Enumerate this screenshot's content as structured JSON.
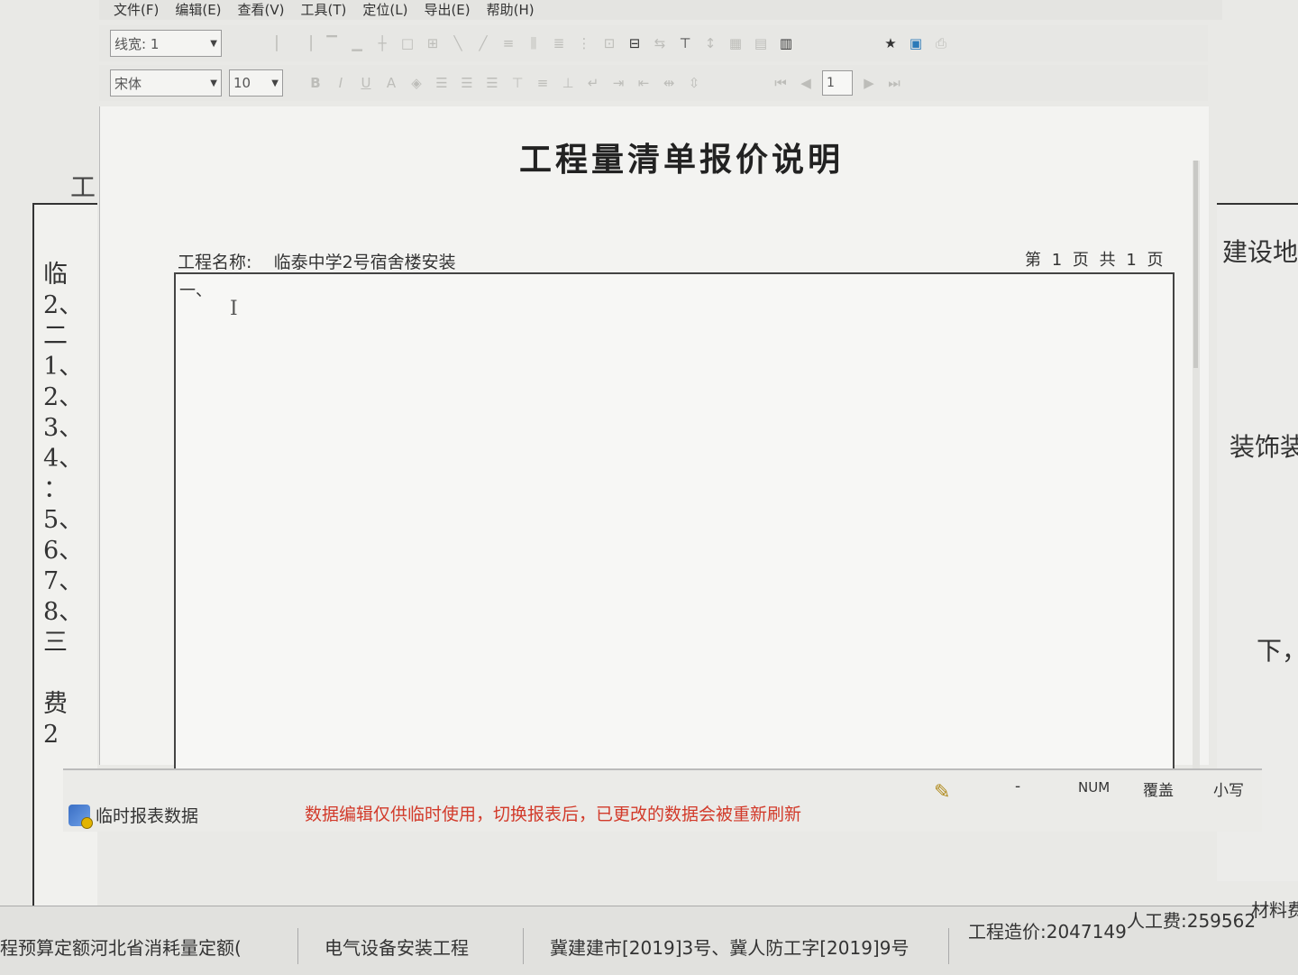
{
  "menu": [
    "文件(F)",
    "编辑(E)",
    "查看(V)",
    "工具(T)",
    "定位(L)",
    "导出(E)",
    "帮助(H)"
  ],
  "toolbar1": {
    "line_width_label": "线宽: 1"
  },
  "toolbar2": {
    "font_name": "宋体",
    "font_size": "10",
    "page_number": "1"
  },
  "report": {
    "title": "工程量清单报价说明",
    "project_label": "工程名称:",
    "project_name": "临泰中学2号宿舍楼安装",
    "page_info": "第 1 页 共 1 页",
    "content_first_line": "一、"
  },
  "background_doc": {
    "left_top": "工",
    "left_lines": [
      "临",
      "2、",
      "二",
      "1、",
      "2、",
      "3、",
      "4、",
      "：",
      "5、",
      "6、",
      "7、",
      "8、",
      "三",
      "",
      "费",
      "2"
    ],
    "right_1": "建设地",
    "right_2": "装饰装",
    "right_3": "下，"
  },
  "statusbar": {
    "window_title": "临时报表数据",
    "warning": "数据编辑仅供临时使用，切换报表后，已更改的数据会被重新刷新",
    "dash": "-",
    "num": "NUM",
    "overwrite": "覆盖",
    "lowercase": "小写"
  },
  "bottombar": {
    "quota": "程预算定额河北省消耗量定额(",
    "category": "电气设备安装工程",
    "document": "冀建建市[2019]3号、冀人防工字[2019]9号",
    "cost": "工程造价:2047149",
    "labor": "人工费:259562",
    "material": "材料费"
  }
}
